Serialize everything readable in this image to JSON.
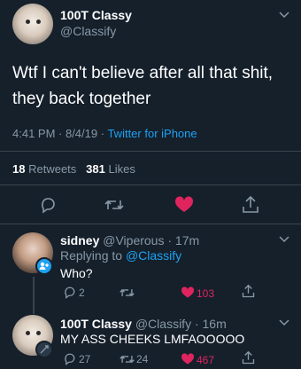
{
  "main_tweet": {
    "author_name": "100T Classy",
    "author_handle": "@Classify",
    "text_line1": "Wtf I can't believe after all that shit,",
    "text_line2": "they back together",
    "time": "4:41 PM · 8/4/19 ·",
    "source": "Twitter for iPhone",
    "retweets_count": "18",
    "retweets_label": "Retweets",
    "likes_count": "381",
    "likes_label": "Likes"
  },
  "replies": [
    {
      "name": "sidney",
      "handle_time": "@Viperous · 17m",
      "replying_prefix": "Replying to",
      "replying_handle": "@Classify",
      "text": "Who?",
      "reply_count": "2",
      "retweet_count": "",
      "like_count": "103"
    },
    {
      "name": "100T Classy",
      "handle_time": "@Classify · 16m",
      "text": "MY ASS CHEEKS LMFAOOOOO",
      "reply_count": "27",
      "retweet_count": "24",
      "like_count": "467"
    }
  ],
  "colors": {
    "background": "#15202b",
    "muted": "#8899a6",
    "link": "#1da1f2",
    "like": "#e0245e"
  }
}
